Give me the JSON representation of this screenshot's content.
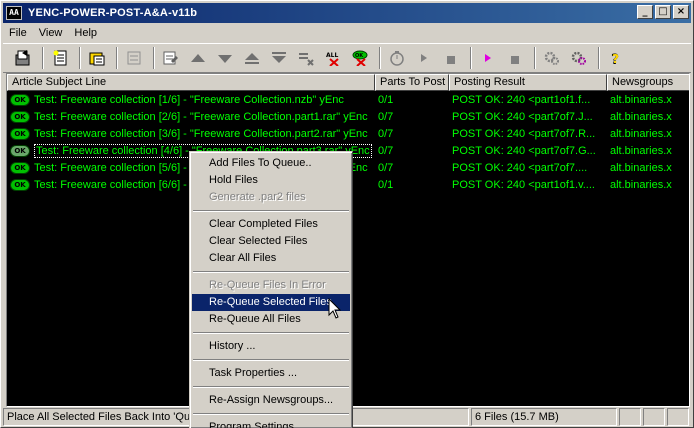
{
  "window": {
    "title": "YENC-POWER-POST-A&A-v11b",
    "app_icon_text": "AA"
  },
  "menu": [
    "File",
    "View",
    "Help"
  ],
  "toolbar": {
    "icons": [
      "post-icon",
      "add-files-icon",
      "open-icon",
      "disabled-icon",
      "edit-icon",
      "move-up-icon",
      "move-down-icon",
      "move-top-icon",
      "move-bottom-icon",
      "clear-icon",
      "all-delete-icon",
      "ok-delete-icon",
      "timer-icon",
      "play-icon",
      "stop-icon",
      "play-magenta-icon",
      "stop2-icon",
      "settings-icon",
      "settings2-icon",
      "help-icon"
    ],
    "all_label": "ALL",
    "ok_label": "OK"
  },
  "list": {
    "columns": [
      "Article Subject Line",
      "Parts To Post",
      "Posting Result",
      "Newsgroups"
    ],
    "rows": [
      {
        "subject": "Test: Freeware collection [1/6] - \"Freeware Collection.nzb\" yEnc",
        "parts": "0/1",
        "result": "POST OK: 240 <part1of1.f...",
        "group": "alt.binaries.x"
      },
      {
        "subject": "Test: Freeware collection [2/6] - \"Freeware Collection.part1.rar\" yEnc",
        "parts": "0/7",
        "result": "POST OK: 240 <part7of7.J...",
        "group": "alt.binaries.x"
      },
      {
        "subject": "Test: Freeware collection [3/6] - \"Freeware Collection.part2.rar\" yEnc",
        "parts": "0/7",
        "result": "POST OK: 240 <part7of7.R...",
        "group": "alt.binaries.x"
      },
      {
        "subject": "Test: Freeware collection [4/6] - \"Freeware Collection.part3.rar\" yEnc",
        "parts": "0/7",
        "result": "POST OK: 240 <part7of7.G...",
        "group": "alt.binaries.x"
      },
      {
        "subject": "Test: Freeware collection [5/6] - \"Freeware Collection.part4.rar\" yEnc",
        "parts": "0/7",
        "result": "POST OK: 240 <part7of7....",
        "group": "alt.binaries.x"
      },
      {
        "subject": "Test: Freeware collection [6/6] - \"Freeware Collection.par2\" yEnc",
        "parts": "0/1",
        "result": "POST OK: 240 <part1of1.v....",
        "group": "alt.binaries.x"
      }
    ],
    "ok_badge": "OK"
  },
  "context_menu": {
    "items": [
      {
        "label": "Add Files To Queue..",
        "disabled": false
      },
      {
        "label": "Hold Files",
        "disabled": false
      },
      {
        "label": "Generate .par2 files",
        "disabled": true
      },
      {
        "sep": true
      },
      {
        "label": "Clear Completed Files",
        "disabled": false
      },
      {
        "label": "Clear Selected Files",
        "disabled": false
      },
      {
        "label": "Clear All Files",
        "disabled": false
      },
      {
        "sep": true
      },
      {
        "label": "Re-Queue Files In Error",
        "disabled": true
      },
      {
        "label": "Re-Queue Selected Files",
        "disabled": false,
        "highlight": true
      },
      {
        "label": "Re-Queue All Files",
        "disabled": false
      },
      {
        "sep": true
      },
      {
        "label": "History ...",
        "disabled": false
      },
      {
        "sep": true
      },
      {
        "label": "Task Properties ...",
        "disabled": false
      },
      {
        "sep": true
      },
      {
        "label": "Re-Assign Newsgroups...",
        "disabled": false
      },
      {
        "sep": true
      },
      {
        "label": "Program Settings ...",
        "disabled": false
      }
    ]
  },
  "status": {
    "hint": "Place All Selected Files Back Into 'Que",
    "files": "6 Files (15.7 MB)"
  },
  "colors": {
    "title_start": "#0a246a",
    "title_end": "#3a6ea5",
    "list_bg": "#000000",
    "list_text": "#00ff00",
    "highlight": "#0a246a"
  }
}
